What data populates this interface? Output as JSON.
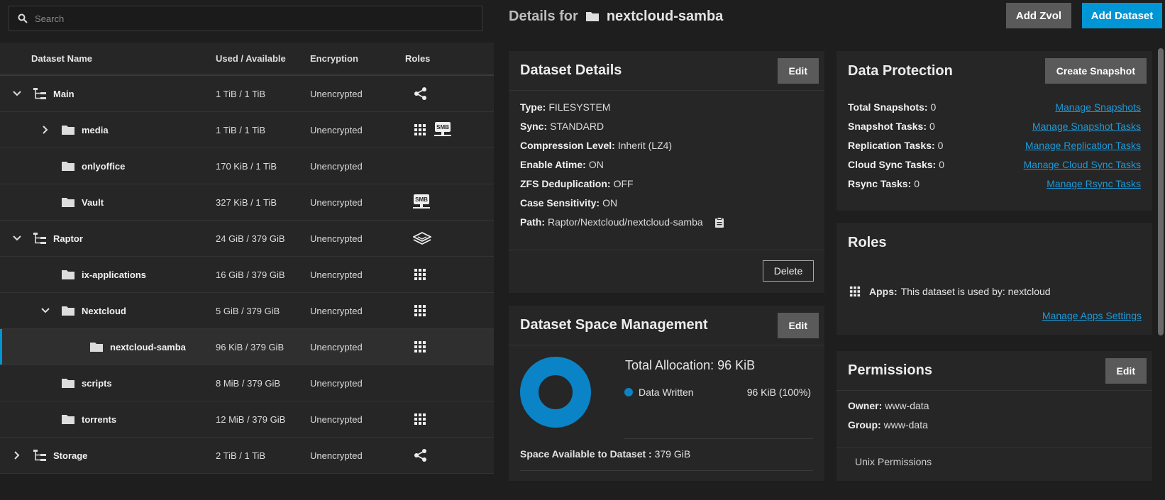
{
  "search": {
    "placeholder": "Search"
  },
  "table": {
    "headers": {
      "name": "Dataset Name",
      "used": "Used / Available",
      "enc": "Encryption",
      "roles": "Roles"
    },
    "rows": [
      {
        "name": "Main",
        "used": "1 TiB / 1 TiB",
        "enc": "Unencrypted"
      },
      {
        "name": "media",
        "used": "1 TiB / 1 TiB",
        "enc": "Unencrypted"
      },
      {
        "name": "onlyoffice",
        "used": "170 KiB / 1 TiB",
        "enc": "Unencrypted"
      },
      {
        "name": "Vault",
        "used": "327 KiB / 1 TiB",
        "enc": "Unencrypted"
      },
      {
        "name": "Raptor",
        "used": "24 GiB / 379 GiB",
        "enc": "Unencrypted"
      },
      {
        "name": "ix-applications",
        "used": "16 GiB / 379 GiB",
        "enc": "Unencrypted"
      },
      {
        "name": "Nextcloud",
        "used": "5 GiB / 379 GiB",
        "enc": "Unencrypted"
      },
      {
        "name": "nextcloud-samba",
        "used": "96 KiB / 379 GiB",
        "enc": "Unencrypted"
      },
      {
        "name": "scripts",
        "used": "8 MiB / 379 GiB",
        "enc": "Unencrypted"
      },
      {
        "name": "torrents",
        "used": "12 MiB / 379 GiB",
        "enc": "Unencrypted"
      },
      {
        "name": "Storage",
        "used": "2 TiB / 1 TiB",
        "enc": "Unencrypted"
      }
    ],
    "smb_label": "SMB"
  },
  "header": {
    "prefix": "Details for",
    "dataset": "nextcloud-samba",
    "add_zvol": "Add Zvol",
    "add_dataset": "Add Dataset"
  },
  "details": {
    "title": "Dataset Details",
    "edit": "Edit",
    "fields": [
      {
        "k": "Type:",
        "v": "FILESYSTEM"
      },
      {
        "k": "Sync:",
        "v": "STANDARD"
      },
      {
        "k": "Compression Level:",
        "v": "Inherit (LZ4)"
      },
      {
        "k": "Enable Atime:",
        "v": "ON"
      },
      {
        "k": "ZFS Deduplication:",
        "v": "OFF"
      },
      {
        "k": "Case Sensitivity:",
        "v": "ON"
      },
      {
        "k": "Path:",
        "v": "Raptor/Nextcloud/nextcloud-samba"
      }
    ],
    "delete": "Delete"
  },
  "space": {
    "title": "Dataset Space Management",
    "edit": "Edit",
    "total_label": "Total Allocation:",
    "total_value": "96 KiB",
    "legend_label": "Data Written",
    "legend_value": "96 KiB (100%)",
    "available_label": "Space Available to Dataset :",
    "available_value": "379 GiB",
    "data_written_fraction": 1.0,
    "color": "#0a84c6"
  },
  "protection": {
    "title": "Data Protection",
    "create": "Create Snapshot",
    "items": [
      {
        "k": "Total Snapshots:",
        "v": "0",
        "link": "Manage Snapshots"
      },
      {
        "k": "Snapshot Tasks:",
        "v": "0",
        "link": "Manage Snapshot Tasks"
      },
      {
        "k": "Replication Tasks:",
        "v": "0",
        "link": "Manage Replication Tasks"
      },
      {
        "k": "Cloud Sync Tasks:",
        "v": "0",
        "link": "Manage Cloud Sync Tasks"
      },
      {
        "k": "Rsync Tasks:",
        "v": "0",
        "link": "Manage Rsync Tasks"
      }
    ]
  },
  "roles": {
    "title": "Roles",
    "apps_label": "Apps:",
    "apps_value": "This dataset is used by: nextcloud",
    "manage": "Manage Apps Settings"
  },
  "permissions": {
    "title": "Permissions",
    "edit": "Edit",
    "owner_label": "Owner:",
    "owner_value": "www-data",
    "group_label": "Group:",
    "group_value": "www-data",
    "unix": "Unix Permissions"
  }
}
